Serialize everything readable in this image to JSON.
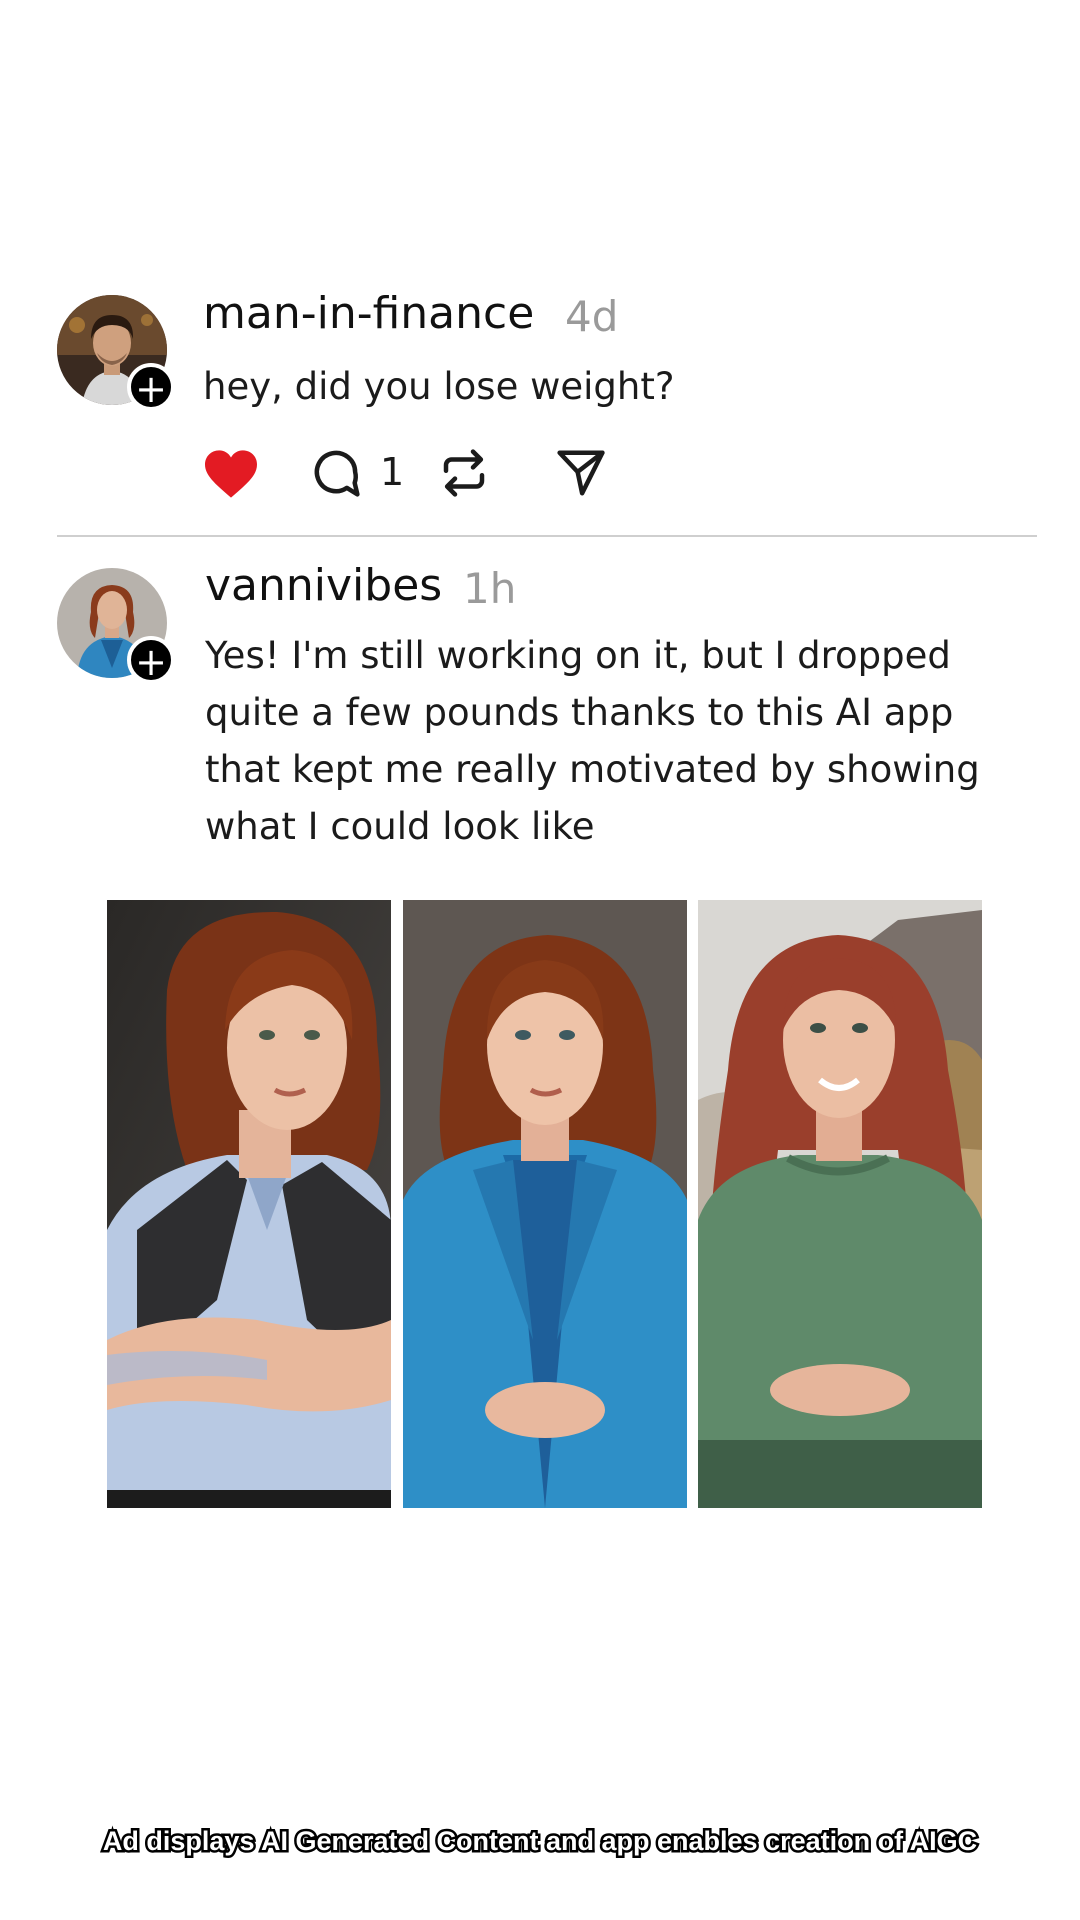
{
  "posts": [
    {
      "username": "man-in-finance",
      "time": "4d",
      "text": "hey, did you lose weight?",
      "liked": true,
      "comment_count": "1",
      "follow_badge": "+"
    },
    {
      "username": "vannivibes",
      "time": "1h",
      "text": "Yes! I'm still working on it, but I dropped quite a few pounds thanks to this AI app that kept me really motivated by showing what I could look like",
      "follow_badge": "+"
    }
  ],
  "images": [
    {
      "icon": "woman-portrait-vest-image"
    },
    {
      "icon": "woman-portrait-blue-blazer-image"
    },
    {
      "icon": "woman-portrait-green-sweater-image"
    }
  ],
  "disclaimer": "Ad displays AI Generated Content and app enables creation of AIGC",
  "colors": {
    "like": "#e31b23",
    "text": "#1b1b1b",
    "muted": "#9a9a9a",
    "divider": "#cfcfcf"
  }
}
